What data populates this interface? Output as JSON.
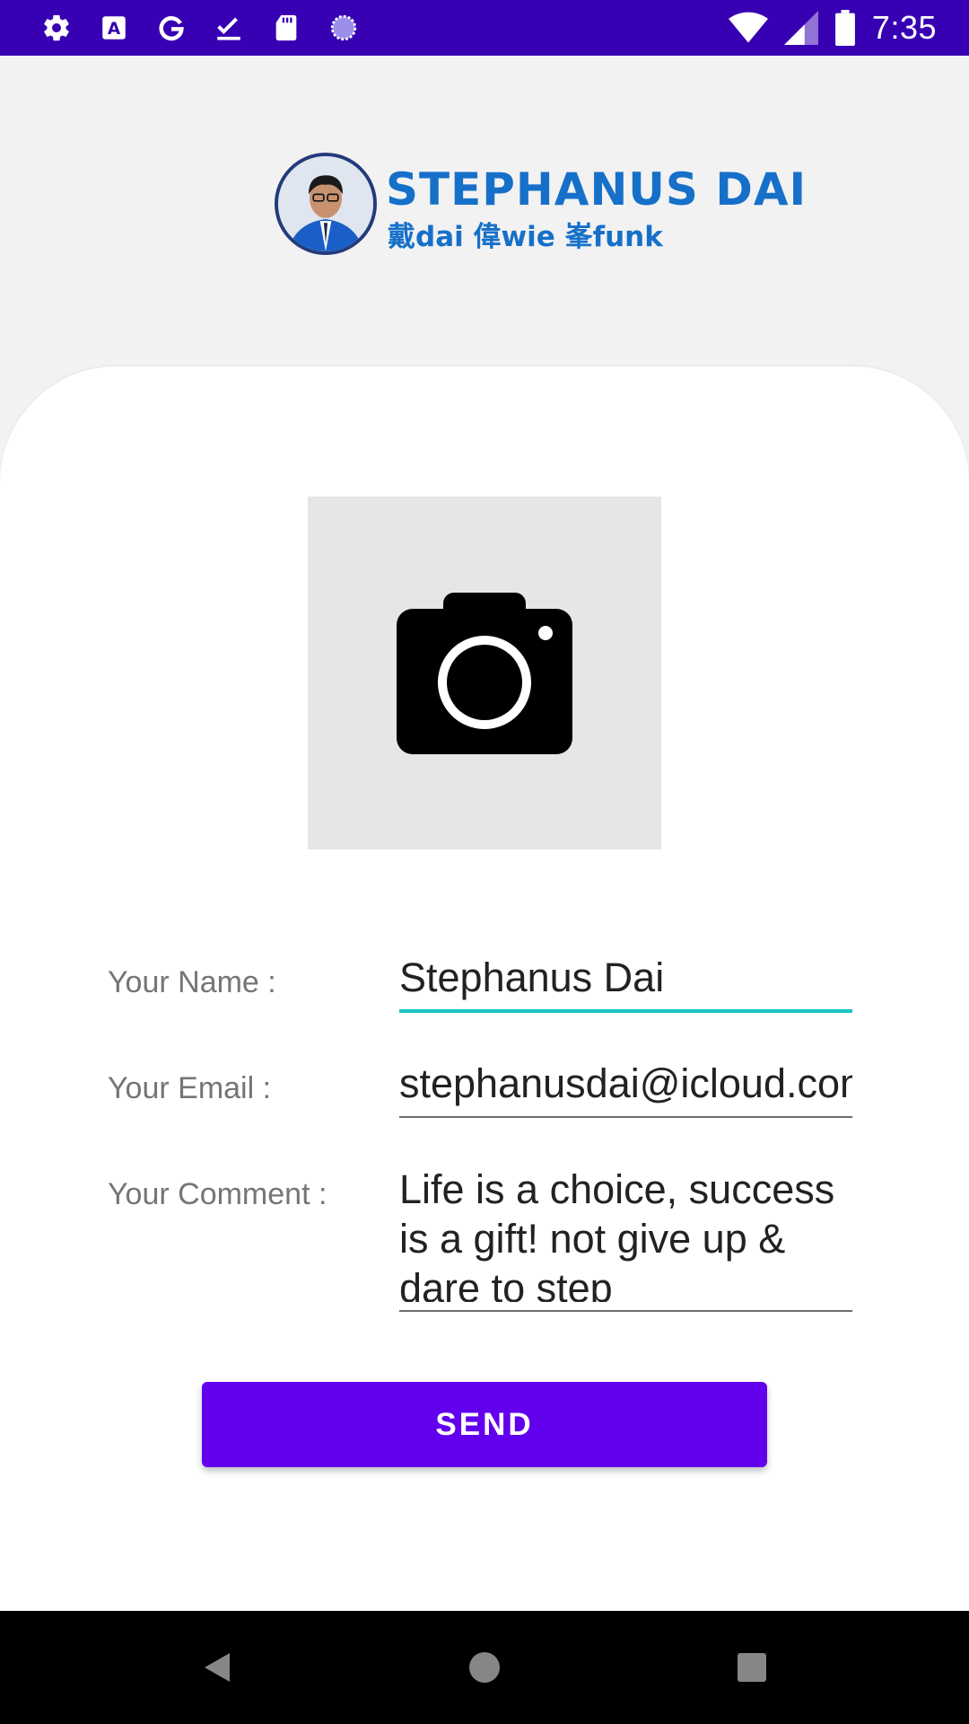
{
  "status_bar": {
    "time": "7:35",
    "left_icons": [
      "settings-icon",
      "font-a-icon",
      "google-g-icon",
      "task-check-icon",
      "sd-card-icon",
      "loading-circle-icon"
    ],
    "right_icons": [
      "wifi-icon",
      "signal-icon",
      "battery-icon"
    ]
  },
  "header": {
    "logo_title": "STEPHANUS DAI",
    "logo_subtitle": "戴dai 偉wie 峯funk"
  },
  "photo": {
    "icon": "camera-icon"
  },
  "form": {
    "name_label": "Your Name :",
    "name_value": "Stephanus Dai",
    "email_label": "Your Email :",
    "email_value": "stephanusdai@icloud.com",
    "comment_label": "Your Comment :",
    "comment_value": "Life is a choice, success is a gift! not give up & dare to step"
  },
  "send_button": {
    "label": "SEND"
  },
  "colors": {
    "status_bar": "#3700b3",
    "button": "#6200ee",
    "active_underline": "#19c6c6"
  },
  "nav": [
    "back-icon",
    "home-icon",
    "recents-icon"
  ]
}
